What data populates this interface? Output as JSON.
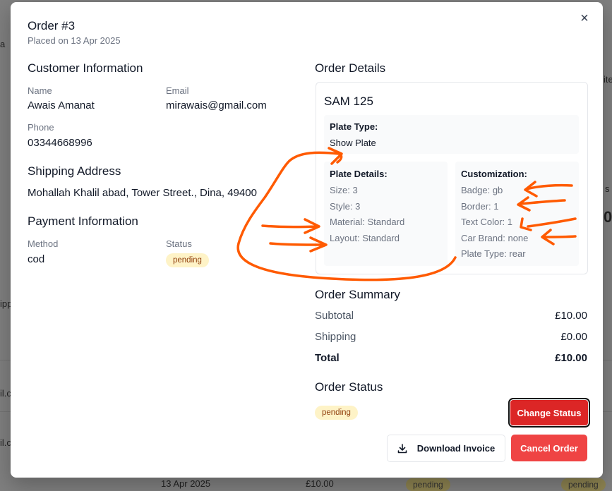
{
  "background": {
    "frag_a": "a",
    "frag_ite": "ite",
    "frag_s": "s",
    "frag_0": "0",
    "frag_ipp": "ipp",
    "frag_ilc1": "il.c",
    "frag_ilc2": "il.c",
    "frag_ilc3": "il.c",
    "frag_date": "13 Apr 2025",
    "frag_price": "£10.00",
    "frag_badge1": "pending",
    "frag_badge2": "pending"
  },
  "modal": {
    "title": "Order #3",
    "subtitle": "Placed on 13 Apr 2025",
    "close_glyph": "×"
  },
  "customer": {
    "heading": "Customer Information",
    "name_label": "Name",
    "name": "Awais Amanat",
    "email_label": "Email",
    "email": "mirawais@gmail.com",
    "phone_label": "Phone",
    "phone": "03344668996"
  },
  "shipping": {
    "heading": "Shipping Address",
    "address": "Mohallah Khalil abad, Tower Street., Dina, 49400"
  },
  "payment": {
    "heading": "Payment Information",
    "method_label": "Method",
    "method": "cod",
    "status_label": "Status",
    "status": "pending"
  },
  "order_details": {
    "heading": "Order Details",
    "plate_name": "SAM 125",
    "plate_type_label": "Plate Type:",
    "plate_type": "Show Plate",
    "plate_details_label": "Plate Details:",
    "plate_details": [
      "Size: 3",
      "Style: 3",
      "Material: Standard",
      "Layout: Standard"
    ],
    "customization_label": "Customization:",
    "customization": [
      "Badge: gb",
      "Border: 1",
      "Text Color: 1",
      "Car Brand: none",
      "Plate Type: rear"
    ]
  },
  "summary": {
    "heading": "Order Summary",
    "subtotal_label": "Subtotal",
    "subtotal": "£10.00",
    "shipping_label": "Shipping",
    "shipping": "£0.00",
    "total_label": "Total",
    "total": "£10.00"
  },
  "order_status": {
    "heading": "Order Status",
    "status": "pending",
    "change_button": "Change Status"
  },
  "actions": {
    "download_invoice": "Download Invoice",
    "cancel_order": "Cancel Order"
  },
  "colors": {
    "annotation": "#ff5a00",
    "danger": "#dc2626",
    "pending_bg": "#fef3c7"
  }
}
